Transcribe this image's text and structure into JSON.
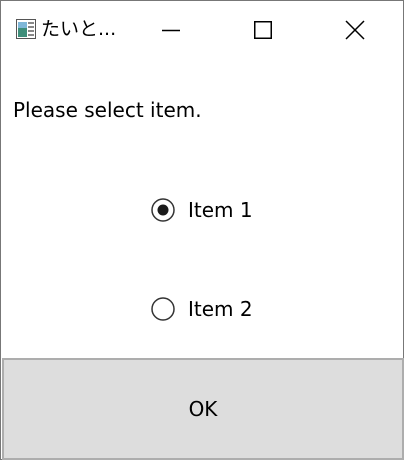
{
  "window": {
    "title": "たいと...",
    "controls": {
      "minimize": "minimize-icon",
      "maximize": "maximize-icon",
      "close": "close-icon"
    }
  },
  "content": {
    "prompt": "Please select item.",
    "options": [
      {
        "label": "Item 1",
        "selected": true
      },
      {
        "label": "Item 2",
        "selected": false
      }
    ]
  },
  "footer": {
    "ok_label": "OK"
  },
  "colors": {
    "button_bg": "#dddddd",
    "button_border": "#adadad",
    "radio_border": "#333333"
  }
}
